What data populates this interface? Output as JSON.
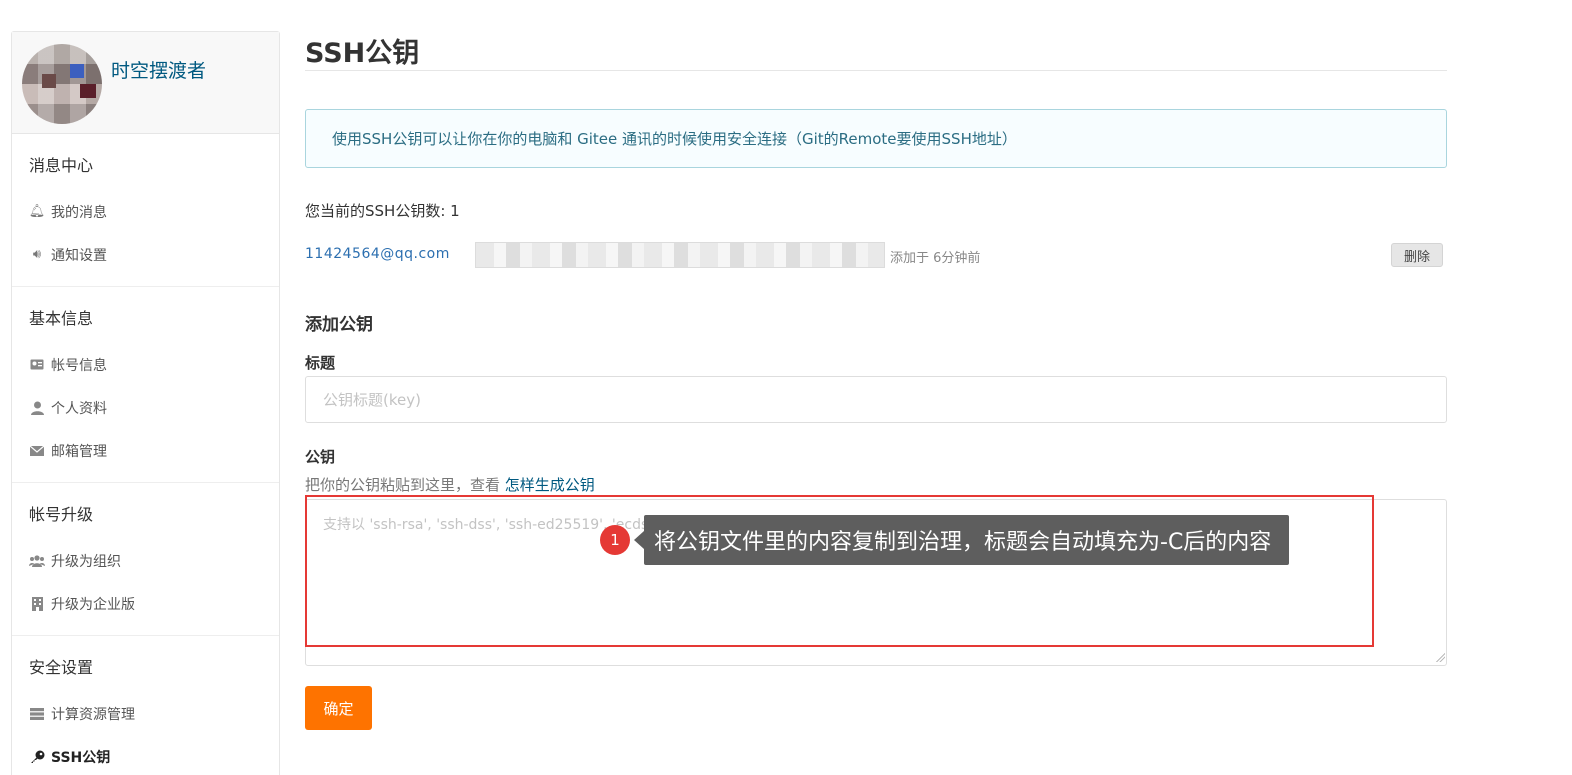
{
  "sidebar": {
    "username": "时空摆渡者",
    "sections": [
      {
        "title": "消息中心",
        "items": [
          {
            "label": "我的消息",
            "icon": "bell-icon"
          },
          {
            "label": "通知设置",
            "icon": "volume-icon"
          }
        ]
      },
      {
        "title": "基本信息",
        "items": [
          {
            "label": "帐号信息",
            "icon": "id-card-icon"
          },
          {
            "label": "个人资料",
            "icon": "user-icon"
          },
          {
            "label": "邮箱管理",
            "icon": "envelope-icon"
          }
        ]
      },
      {
        "title": "帐号升级",
        "items": [
          {
            "label": "升级为组织",
            "icon": "users-icon"
          },
          {
            "label": "升级为企业版",
            "icon": "building-icon"
          }
        ]
      },
      {
        "title": "安全设置",
        "items": [
          {
            "label": "计算资源管理",
            "icon": "server-icon"
          },
          {
            "label": "SSH公钥",
            "icon": "key-icon",
            "active": true
          }
        ]
      }
    ]
  },
  "main": {
    "page_title": "SSH公钥",
    "info_text": "使用SSH公钥可以让你在你的电脑和 Gitee 通讯的时候使用安全连接（Git的Remote要使用SSH地址）",
    "key_count_text": "您当前的SSH公钥数: 1",
    "existing_key": {
      "title": "11424564@qq.com",
      "time_text": "添加于 6分钟前",
      "delete_label": "删除"
    },
    "add_section_title": "添加公钥",
    "title_label": "标题",
    "title_placeholder": "公钥标题(key)",
    "key_label": "公钥",
    "key_hint_prefix": "把你的公钥粘贴到这里，查看 ",
    "key_hint_link": "怎样生成公钥",
    "key_placeholder": "支持以 'ssh-rsa', 'ssh-dss', 'ssh-ed25519', 'ecdsa-sha2-nistp256', 'ecdsa-sha2-nistp384', or 'ecdsa-sha2-nistp521' 开头",
    "confirm_label": "确定"
  },
  "annotation": {
    "number": "1",
    "text": "将公钥文件里的内容复制到治理，标题会自动填充为-C后的内容"
  },
  "colors": {
    "accent_orange": "#fe7300",
    "link_blue": "#005980",
    "highlight_red": "#e53935",
    "tooltip_gray": "#5e5e5e"
  }
}
